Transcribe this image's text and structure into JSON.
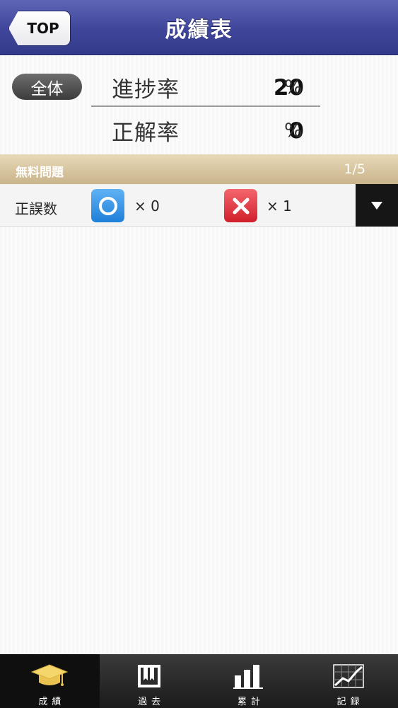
{
  "header": {
    "back_label": "TOP",
    "title": "成績表"
  },
  "summary": {
    "scope": "全体",
    "progress_label": "進捗率",
    "progress_value": "20",
    "progress_unit": "%",
    "accuracy_label": "正解率",
    "accuracy_value": "0",
    "accuracy_unit": "%"
  },
  "section": {
    "title": "無料問題",
    "page": "1/5"
  },
  "score_row": {
    "label": "正誤数",
    "correct_icon": "circle-icon",
    "correct_count": "× 0",
    "wrong_icon": "cross-icon",
    "wrong_count": "× 1"
  },
  "tabbar": {
    "items": [
      {
        "label": "成績",
        "icon": "graduation-cap-icon",
        "active": true
      },
      {
        "label": "過去",
        "icon": "book-icon",
        "active": false
      },
      {
        "label": "累計",
        "icon": "bar-chart-icon",
        "active": false
      },
      {
        "label": "記録",
        "icon": "line-chart-icon",
        "active": false
      }
    ]
  },
  "colors": {
    "header": "#3f4599",
    "section_bar": "#c9b48b",
    "correct": "#1f7fd8",
    "wrong": "#d01f2c"
  }
}
